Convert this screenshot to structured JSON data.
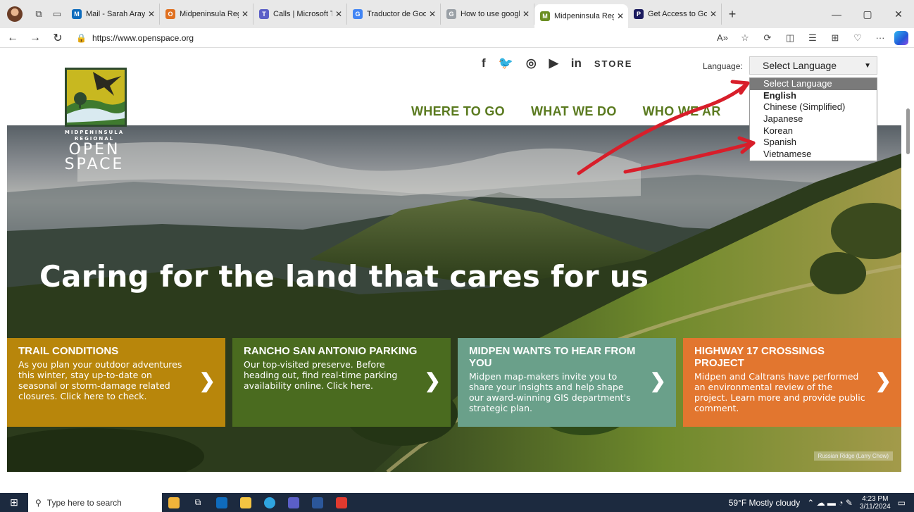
{
  "browser": {
    "tabs": [
      {
        "title": "Mail - Sarah Araya -",
        "color": "#0f6cbd",
        "glyph": "M"
      },
      {
        "title": "Midpeninsula Regio",
        "color": "#e07020",
        "glyph": "O"
      },
      {
        "title": "Calls | Microsoft Tea",
        "color": "#5b5fc7",
        "glyph": "T"
      },
      {
        "title": "Traductor de Googl",
        "color": "#4285f4",
        "glyph": "G"
      },
      {
        "title": "How to use google",
        "color": "#9aa0a6",
        "glyph": "G"
      },
      {
        "title": "Midpeninsula Regio",
        "color": "#6b8e23",
        "glyph": "M",
        "active": true
      },
      {
        "title": "Get Access to Gove",
        "color": "#1a1a5e",
        "glyph": "P"
      }
    ],
    "url": "https://www.openspace.org"
  },
  "site": {
    "logo": {
      "line1": "MIDPENINSULA",
      "line2": "REGIONAL",
      "line3": "OPEN",
      "line4": "SPACE"
    },
    "store_label": "STORE",
    "language_label": "Language:",
    "language_select_value": "Select Language",
    "language_options": [
      "Select Language",
      "English",
      "Chinese (Simplified)",
      "Japanese",
      "Korean",
      "Spanish",
      "Vietnamese"
    ],
    "nav": [
      "WHERE TO GO",
      "WHAT WE DO",
      "WHO WE AR"
    ],
    "headline": "Caring for the land that cares for us",
    "photo_caption": "Russian Ridge (Larry Chow)",
    "cards": [
      {
        "title": "TRAIL CONDITIONS",
        "text": "As you plan your outdoor adventures this winter, stay up-to-date on seasonal or storm-damage related closures. Click here to check.",
        "color": "#b8860b"
      },
      {
        "title": "RANCHO SAN ANTONIO PARKING",
        "text": "Our top-visited preserve. Before heading out, find real-time parking availability online. Click here.",
        "color": "#4a6b1f"
      },
      {
        "title": "MIDPEN WANTS TO HEAR FROM YOU",
        "text": "Midpen map-makers invite you to share your insights and help shape our award-winning GIS department's strategic plan.",
        "color": "#6aa08a"
      },
      {
        "title": "HIGHWAY 17 CROSSINGS PROJECT",
        "text": "Midpen and Caltrans have performed an environmental review of the project. Learn more and provide public comment.",
        "color": "#e2762f"
      }
    ]
  },
  "taskbar": {
    "search_placeholder": "Type here to search",
    "weather": "59°F  Mostly cloudy",
    "time": "4:23 PM",
    "date": "3/11/2024"
  }
}
